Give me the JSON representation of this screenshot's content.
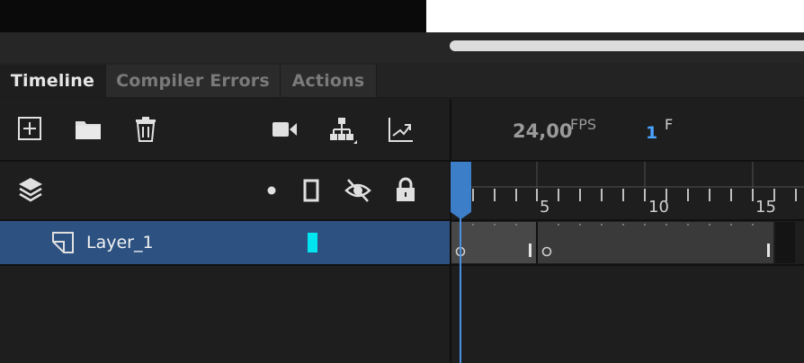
{
  "tabs": [
    {
      "label": "Timeline",
      "active": true
    },
    {
      "label": "Compiler Errors",
      "active": false
    },
    {
      "label": "Actions",
      "active": false
    }
  ],
  "toolbar": {
    "icons": [
      "new-layer-icon",
      "new-folder-icon",
      "delete-icon",
      "camera-icon",
      "layer-parenting-icon",
      "graph-icon"
    ],
    "fps_value": "24,00",
    "fps_unit": "FPS",
    "frame_value": "1",
    "frame_unit": "F"
  },
  "layer_header": {
    "icons": [
      "layers-icon",
      "dot-icon",
      "outline-icon",
      "visibility-off-icon",
      "lock-icon"
    ]
  },
  "ruler": {
    "labels": [
      "5",
      "10",
      "15"
    ]
  },
  "layers": [
    {
      "name": "Layer_1",
      "color": "#00e5f0",
      "selected": true
    }
  ],
  "current_frame": 1,
  "colors": {
    "accent": "#4a90e2",
    "selection": "#2d5181",
    "layer_color": "#00e5f0"
  }
}
